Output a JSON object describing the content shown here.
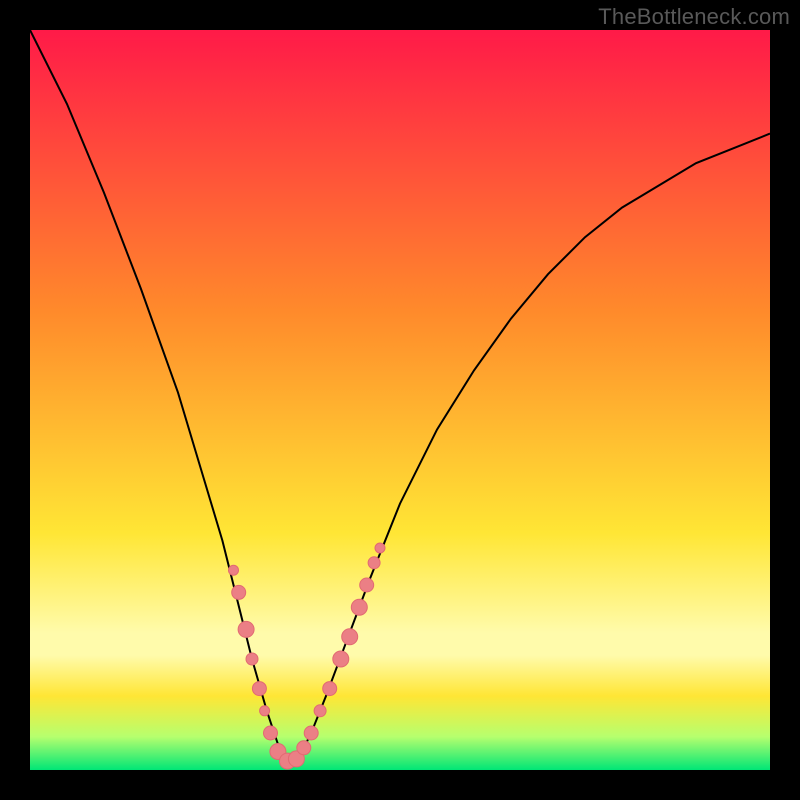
{
  "watermark": "TheBottleneck.com",
  "colors": {
    "frame": "#000000",
    "grad_top": "#ff1a48",
    "grad_mid1": "#ff8a2b",
    "grad_mid2": "#ffe635",
    "grad_band_pale": "#fffbab",
    "grad_green_light": "#b6ff6e",
    "grad_green": "#00e676",
    "curve": "#000000",
    "dot_fill": "#eb7f85",
    "dot_stroke": "#e26a72"
  },
  "chart_data": {
    "type": "line",
    "title": "",
    "xlabel": "",
    "ylabel": "",
    "xlim": [
      0,
      100
    ],
    "ylim": [
      0,
      100
    ],
    "series": [
      {
        "name": "bottleneck-curve",
        "x": [
          0,
          5,
          10,
          15,
          20,
          23,
          26,
          28,
          30,
          32,
          33.5,
          35,
          36.5,
          38,
          40,
          43,
          46,
          50,
          55,
          60,
          65,
          70,
          75,
          80,
          85,
          90,
          95,
          100
        ],
        "y": [
          100,
          90,
          78,
          65,
          51,
          41,
          31,
          23,
          15,
          8,
          3.5,
          1,
          2,
          5,
          10,
          18,
          26,
          36,
          46,
          54,
          61,
          67,
          72,
          76,
          79,
          82,
          84,
          86
        ]
      }
    ],
    "dots": [
      {
        "x": 27.5,
        "y": 27,
        "r": 5
      },
      {
        "x": 28.2,
        "y": 24,
        "r": 7
      },
      {
        "x": 29.2,
        "y": 19,
        "r": 8
      },
      {
        "x": 30.0,
        "y": 15,
        "r": 6
      },
      {
        "x": 31.0,
        "y": 11,
        "r": 7
      },
      {
        "x": 31.7,
        "y": 8,
        "r": 5
      },
      {
        "x": 32.5,
        "y": 5,
        "r": 7
      },
      {
        "x": 33.5,
        "y": 2.5,
        "r": 8
      },
      {
        "x": 34.8,
        "y": 1.2,
        "r": 8
      },
      {
        "x": 36.0,
        "y": 1.5,
        "r": 8
      },
      {
        "x": 37.0,
        "y": 3,
        "r": 7
      },
      {
        "x": 38.0,
        "y": 5,
        "r": 7
      },
      {
        "x": 39.2,
        "y": 8,
        "r": 6
      },
      {
        "x": 40.5,
        "y": 11,
        "r": 7
      },
      {
        "x": 42.0,
        "y": 15,
        "r": 8
      },
      {
        "x": 43.2,
        "y": 18,
        "r": 8
      },
      {
        "x": 44.5,
        "y": 22,
        "r": 8
      },
      {
        "x": 45.5,
        "y": 25,
        "r": 7
      },
      {
        "x": 46.5,
        "y": 28,
        "r": 6
      },
      {
        "x": 47.3,
        "y": 30,
        "r": 5
      }
    ],
    "gradient_stops": [
      {
        "offset": 0.0,
        "key": "grad_top"
      },
      {
        "offset": 0.38,
        "key": "grad_mid1"
      },
      {
        "offset": 0.68,
        "key": "grad_mid2"
      },
      {
        "offset": 0.815,
        "key": "grad_band_pale"
      },
      {
        "offset": 0.845,
        "key": "grad_band_pale"
      },
      {
        "offset": 0.9,
        "key": "grad_mid2"
      },
      {
        "offset": 0.955,
        "key": "grad_green_light"
      },
      {
        "offset": 1.0,
        "key": "grad_green"
      }
    ]
  }
}
